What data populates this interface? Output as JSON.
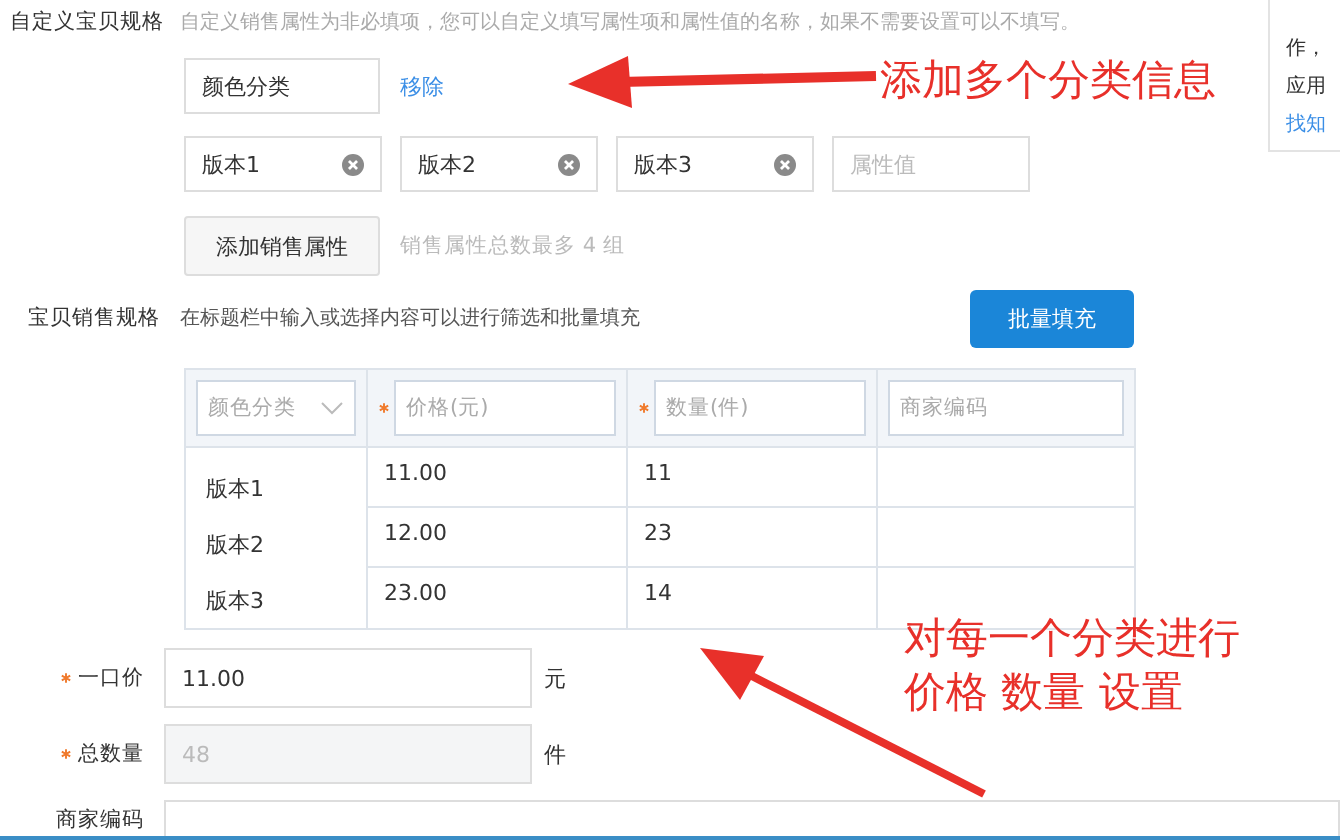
{
  "custom_spec": {
    "label": "自定义宝贝规格",
    "description": "自定义销售属性为非必填项，您可以自定义填写属性项和属性值的名称，如果不需要设置可以不填写。",
    "attribute_name": "颜色分类",
    "remove_link": "移除",
    "values": [
      {
        "kind": "value",
        "text": "版本1"
      },
      {
        "kind": "value",
        "text": "版本2"
      },
      {
        "kind": "value",
        "text": "版本3"
      },
      {
        "kind": "empty",
        "placeholder": "属性值"
      }
    ],
    "add_button": "添加销售属性",
    "add_hint": "销售属性总数最多 4 组"
  },
  "sales_spec": {
    "label": "宝贝销售规格",
    "description": "在标题栏中输入或选择内容可以进行筛选和批量填充",
    "batch_button": "批量填充",
    "columns": [
      {
        "kind": "select",
        "placeholder": "颜色分类",
        "required": false
      },
      {
        "kind": "input",
        "placeholder": "价格(元)",
        "required": true
      },
      {
        "kind": "input",
        "placeholder": "数量(件)",
        "required": true
      },
      {
        "kind": "input",
        "placeholder": "商家编码",
        "required": false
      }
    ],
    "rows": [
      {
        "name": "版本1",
        "price": "11.00",
        "quantity": "11"
      },
      {
        "name": "版本2",
        "price": "12.00",
        "quantity": "23"
      },
      {
        "name": "版本3",
        "price": "23.00",
        "quantity": "14"
      }
    ]
  },
  "fields": [
    {
      "label": "一口价",
      "required": true,
      "value": "11.00",
      "unit": "元",
      "disabled": false,
      "wide": false
    },
    {
      "label": "总数量",
      "required": true,
      "value": "48",
      "unit": "件",
      "disabled": true,
      "wide": false
    },
    {
      "label": "商家编码",
      "required": false,
      "disabled": false,
      "wide": true
    }
  ],
  "side_panel": {
    "lines": [
      {
        "kind": "text",
        "text": "作，"
      },
      {
        "kind": "text",
        "text": "应用"
      },
      {
        "kind": "link",
        "text": "找知"
      }
    ]
  },
  "annotations": [
    {
      "lines": [
        "添加多个分类信息"
      ]
    },
    {
      "lines": [
        "对每一个分类进行",
        "价格 数量 设置"
      ]
    }
  ]
}
